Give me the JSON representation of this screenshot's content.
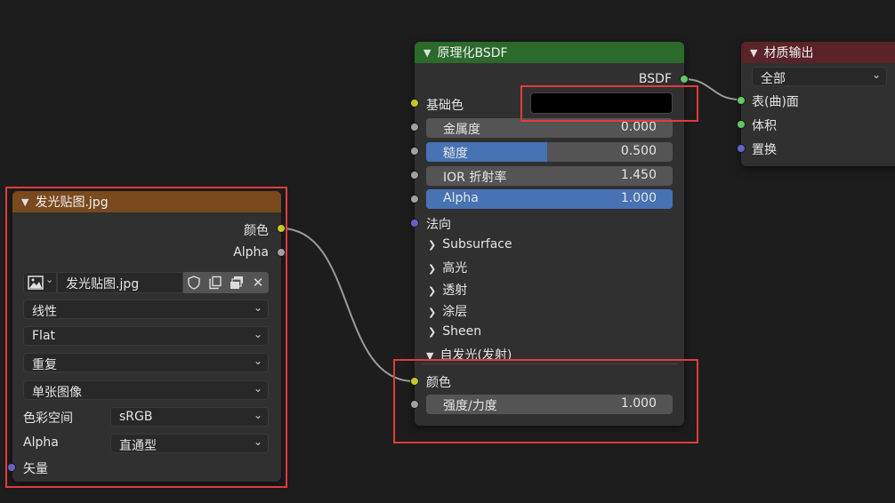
{
  "bsdf_node": {
    "title": "原理化BSDF",
    "output_label": "BSDF",
    "base_color_label": "基础色",
    "base_color_value": "#000000",
    "fields": [
      {
        "label": "金属度",
        "value": "0.000",
        "fraction": 0.0
      },
      {
        "label": "糙度",
        "value": "0.500",
        "fraction": 0.5
      },
      {
        "label": "IOR 折射率",
        "value": "1.450",
        "fraction": 0.0
      },
      {
        "label": "Alpha",
        "value": "1.000",
        "fraction": 1.0
      }
    ],
    "normal_label": "法向",
    "panels": [
      "Subsurface",
      "高光",
      "透射",
      "涂层",
      "Sheen"
    ],
    "emission_panel": "自发光(发射)",
    "emission_color_label": "颜色",
    "emission_strength_label": "强度/力度",
    "emission_strength_value": "1.000"
  },
  "output_node": {
    "title": "材质输出",
    "target": "全部",
    "inputs": [
      "表(曲)面",
      "体积",
      "置换"
    ]
  },
  "image_node": {
    "title": "发光贴图.jpg",
    "outputs": [
      "颜色",
      "Alpha"
    ],
    "image_name": "发光贴图.jpg",
    "interpolation": "线性",
    "projection": "Flat",
    "extension": "重复",
    "source": "单张图像",
    "colorspace_label": "色彩空间",
    "colorspace_value": "sRGB",
    "alpha_label": "Alpha",
    "alpha_value": "直通型",
    "vector_label": "矢量"
  },
  "colors": {
    "bsdf_header": "#2b6a2b",
    "output_header": "#5a2328",
    "image_header": "#7a4a1e",
    "accent": "#4772b3",
    "highlight": "#e03c3c"
  }
}
